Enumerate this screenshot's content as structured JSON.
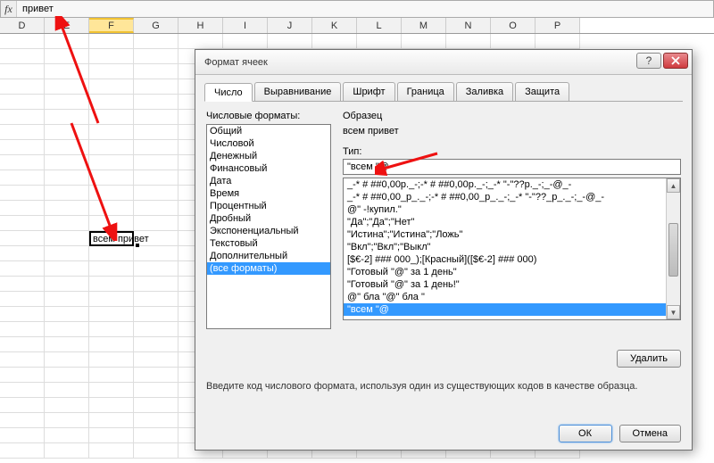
{
  "formula": {
    "value": "привет"
  },
  "columns": [
    "D",
    "E",
    "F",
    "G",
    "H",
    "I",
    "J",
    "K",
    "L",
    "M",
    "N",
    "O",
    "P"
  ],
  "activeCellValue": "всем привет",
  "dialog": {
    "title": "Формат ячеек",
    "tabs": [
      "Число",
      "Выравнивание",
      "Шрифт",
      "Граница",
      "Заливка",
      "Защита"
    ],
    "activeTab": 0,
    "categoryLabel": "Числовые форматы:",
    "categories": [
      "Общий",
      "Числовой",
      "Денежный",
      "Финансовый",
      "Дата",
      "Время",
      "Процентный",
      "Дробный",
      "Экспоненциальный",
      "Текстовый",
      "Дополнительный",
      "(все форматы)"
    ],
    "categorySelected": 11,
    "sampleLabel": "Образец",
    "sampleValue": "всем привет",
    "typeLabel": "Тип:",
    "typeValue": "\"всем \"@",
    "types": [
      "_-* # ##0,00р._-;-* # ##0,00р._-;_-* \"-\"??р._-;_-@_-",
      "_-* # ##0,00_р_._-;-* # ##0,00_р_._-;_-* \"-\"??_р_._-;_-@_-",
      "@\" -!купил.\"",
      "\"Да\";\"Да\";\"Нет\"",
      "\"Истина\";\"Истина\";\"Ложь\"",
      "\"Вкл\";\"Вкл\";\"Выкл\"",
      "[$€-2] ### 000_);[Красный]([$€-2] ### 000)",
      "\"Готовый \"@\" за 1 день\"",
      "\"Готовый \"@\" за 1 день!\"",
      "@\" бла \"@\" бла \"",
      "\"всем \"@"
    ],
    "typeSelected": 10,
    "deleteLabel": "Удалить",
    "hint": "Введите код числового формата, используя один из существующих кодов в качестве образца.",
    "ok": "ОК",
    "cancel": "Отмена"
  }
}
